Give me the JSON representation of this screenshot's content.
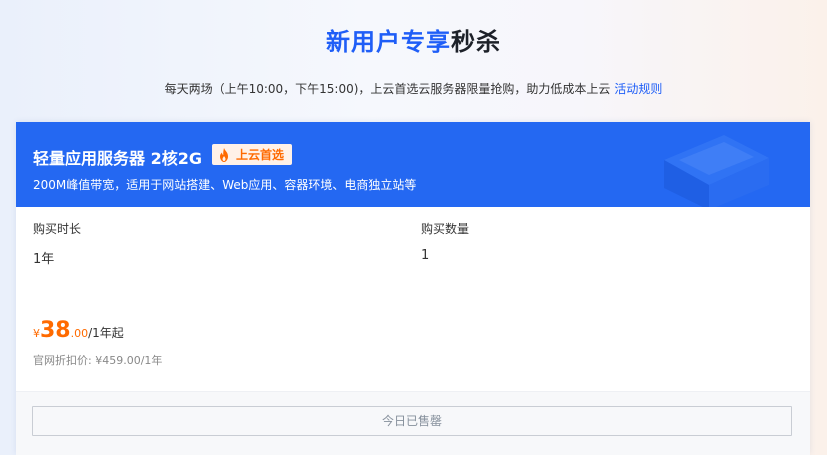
{
  "header": {
    "title_blue": "新用户专享",
    "title_dark": "秒杀",
    "subtitle": "每天两场（上午10:00，下午15:00)，上云首选云服务器限量抢购，助力低成本上云",
    "rules_link": "活动规则"
  },
  "product": {
    "name": "轻量应用服务器 2核2G",
    "badge": "上云首选",
    "description": "200M峰值带宽，适用于网站搭建、Web应用、容器环境、电商独立站等",
    "duration_label": "购买时长",
    "duration_value": "1年",
    "quantity_label": "购买数量",
    "quantity_value": "1",
    "price_currency": "¥",
    "price_integer": "38",
    "price_decimal": ".00",
    "price_unit": "/1年起",
    "original_price": "官网折扣价: ¥459.00/1年",
    "button_label": "今日已售罄"
  },
  "colors": {
    "brand_blue": "#2468f2",
    "price_orange": "#ff6a00"
  },
  "icons": {
    "badge_icon": "flame-icon",
    "header_decoration": "server-illustration"
  }
}
